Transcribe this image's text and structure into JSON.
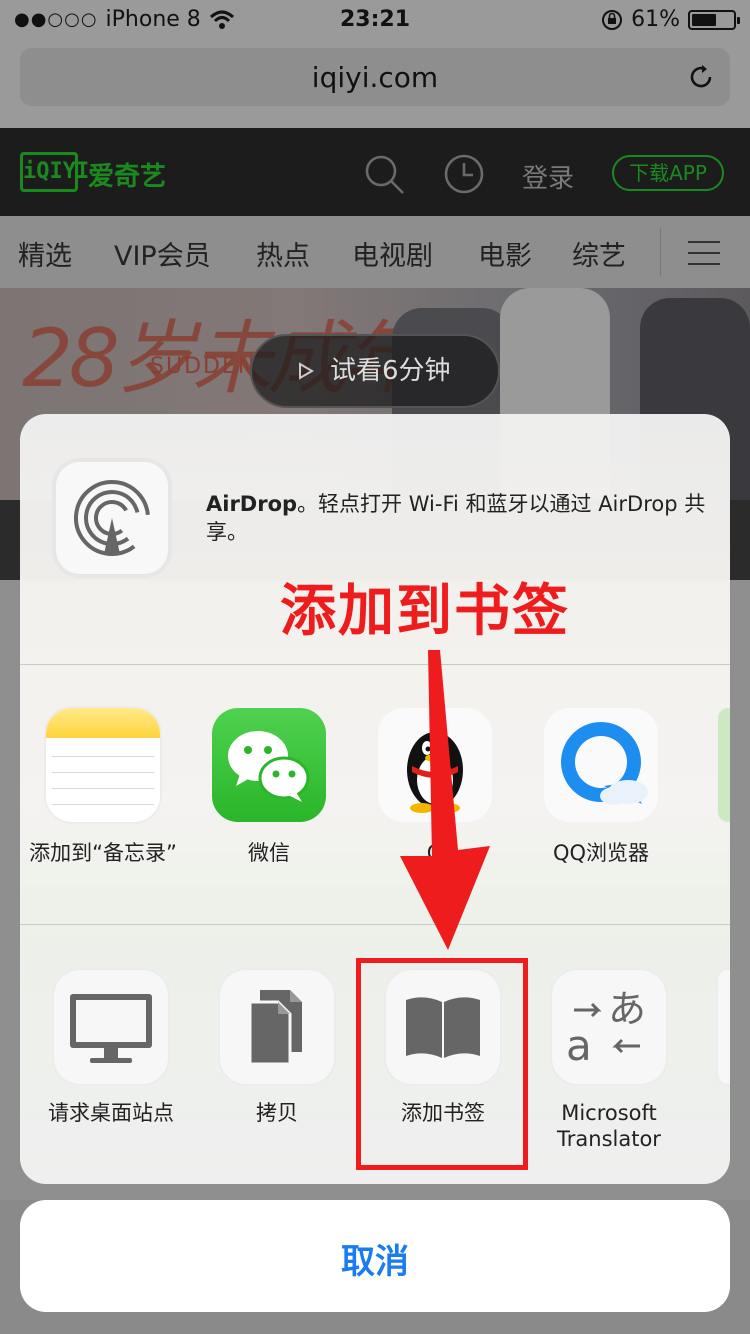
{
  "status_bar": {
    "carrier": "iPhone 8",
    "time": "23:21",
    "battery": "61%",
    "battery_level": 0.61
  },
  "url_bar": {
    "url": "iqiyi.com"
  },
  "site_header": {
    "logo_mark": "iQIYI",
    "logo_text": "爱奇艺",
    "login": "登录",
    "download": "下载APP"
  },
  "nav_tabs": [
    {
      "label": "精选"
    },
    {
      "label": "VIP会员"
    },
    {
      "label": "热点"
    },
    {
      "label": "电视剧"
    },
    {
      "label": "电影"
    },
    {
      "label": "综艺"
    }
  ],
  "banner": {
    "title_art": "28岁未成年",
    "subtitle_art": "SUDDEN",
    "trial_button": "试看6分钟"
  },
  "share_sheet": {
    "airdrop_title": "AirDrop",
    "airdrop_desc": "。轻点打开 Wi-Fi 和蓝牙以通过 AirDrop 共享。",
    "apps_row": [
      {
        "label": "添加到“备忘录”",
        "icon": "notes-icon"
      },
      {
        "label": "微信",
        "icon": "wechat-icon"
      },
      {
        "label": "Q",
        "icon": "qq-icon"
      },
      {
        "label": "QQ浏览器",
        "icon": "qq-browser-icon"
      }
    ],
    "actions_row": [
      {
        "label": "请求桌面站点",
        "icon": "desktop-icon"
      },
      {
        "label": "拷贝",
        "icon": "copy-icon"
      },
      {
        "label": "添加书签",
        "icon": "bookmark-icon"
      },
      {
        "label": "Microsoft Translator",
        "icon": "translator-icon"
      }
    ],
    "cancel": "取消"
  },
  "annotation": {
    "title": "添加到书签",
    "color": "#ee1c1c"
  },
  "colors": {
    "iqiyi_green": "#1b8a1e",
    "ios_blue": "#1a7cf0"
  }
}
